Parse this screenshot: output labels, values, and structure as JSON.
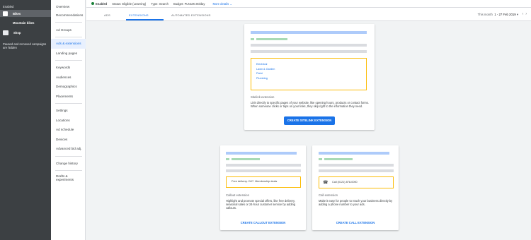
{
  "rail": {
    "enabled_label": "Enabled",
    "campaigns": [
      {
        "label": "Bikes"
      },
      {
        "label": "Mountain bikes"
      },
      {
        "label": "Shop"
      }
    ],
    "hidden_note": "Paused and removed campaigns are hidden"
  },
  "subnav": {
    "items": [
      "Overview",
      "Recommendations",
      "Ad Groups",
      "Ads & extensions",
      "Landing pages",
      "Keywords",
      "Audiences",
      "Demographics",
      "Placements",
      "Settings",
      "Locations",
      "Ad schedule",
      "Devices",
      "Advanced bid adj.",
      "Change history",
      "Drafts & experiments"
    ],
    "selected": "Ads & extensions"
  },
  "status": {
    "enabled": "Enabled",
    "status_label": "Status:",
    "status_value": "Eligible (Learning)",
    "type_label": "Type:",
    "type_value": "Search",
    "budget_label": "Budget:",
    "budget_value": "PLN100.00/day",
    "more_details": "More details"
  },
  "tabs": {
    "ads": "ADS",
    "extensions": "EXTENSIONS",
    "automated": "AUTOMATED EXTENSIONS",
    "date_label": "This month",
    "date_value": "1 - 27 Feb 2019"
  },
  "sitelink_card": {
    "links": [
      "Electrical",
      "Lawn & Garden",
      "Paint",
      "Plumbing"
    ],
    "title": "Sitelink extension",
    "description": "Link directly to specific pages of your website, like opening hours, products or contact forms. When someone clicks or taps on your links, they skip right to the information they need.",
    "button": "CREATE SITELINK EXTENSION"
  },
  "callout_card": {
    "preview_text": "Free delivery. 24/7. Membership deals",
    "title": "Callout extension",
    "description": "Highlight and promote special offers, like free delivery, seasonal sales or 24-hour customer service by adding callouts.",
    "button": "CREATE CALLOUT EXTENSION"
  },
  "call_card": {
    "preview_text": "Call (0121) 878-0000",
    "title": "Call extension",
    "description": "Make it easy for people to reach your business directly by adding a phone number to your ads.",
    "button": "CREATE CALL EXTENSION"
  },
  "colors": {
    "accent": "#1a73e8",
    "status_green": "#188038",
    "preview_border": "#fbbc04",
    "rail_bg": "#3c4043"
  }
}
